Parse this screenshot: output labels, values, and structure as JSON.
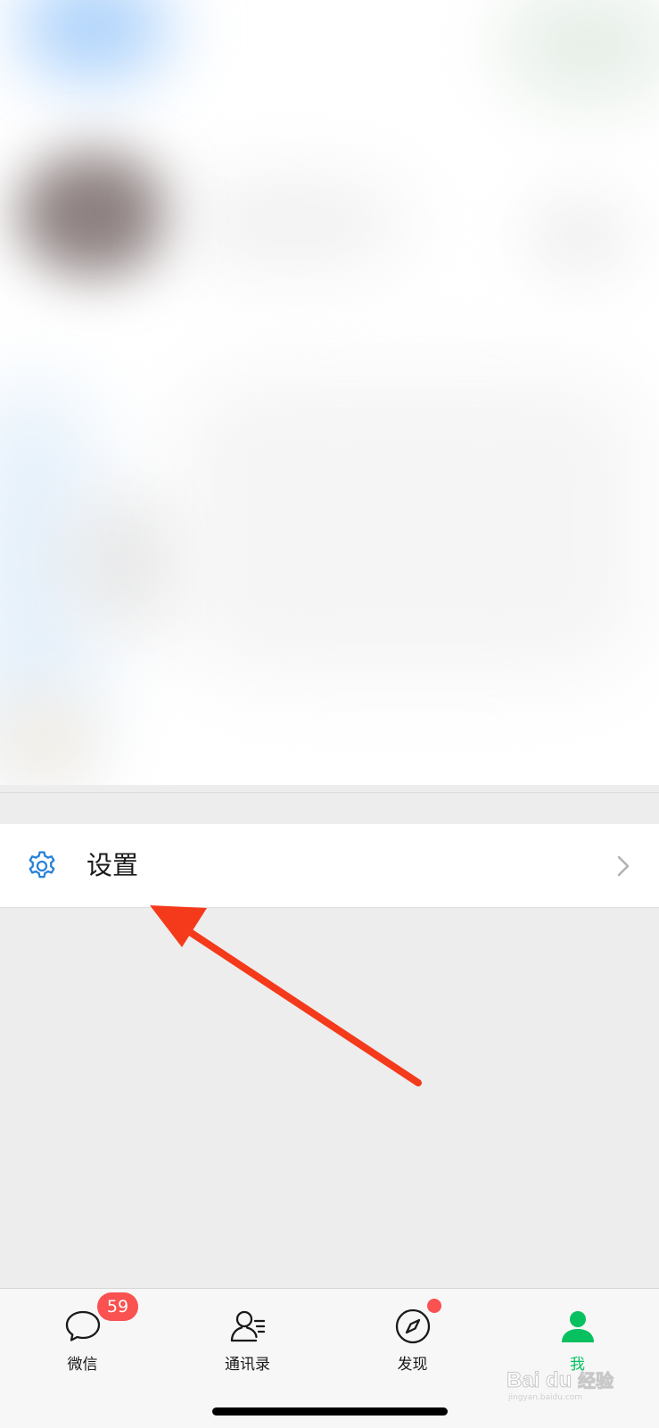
{
  "settings": {
    "label": "设置",
    "icon": "gear-icon",
    "icon_color": "#2782d7"
  },
  "tabs": [
    {
      "label": "微信",
      "icon": "chat-bubble-icon",
      "badge": "59",
      "active": false
    },
    {
      "label": "通讯录",
      "icon": "contacts-icon",
      "active": false
    },
    {
      "label": "发现",
      "icon": "compass-icon",
      "has_dot": true,
      "active": false
    },
    {
      "label": "我",
      "icon": "person-icon",
      "active": true
    }
  ],
  "colors": {
    "accent_green": "#07c160",
    "badge_red": "#fa5151",
    "arrow_red": "#f43a1b"
  },
  "watermark": {
    "text": "Bai du 经验",
    "subtext": "jingyan.baidu.com"
  }
}
